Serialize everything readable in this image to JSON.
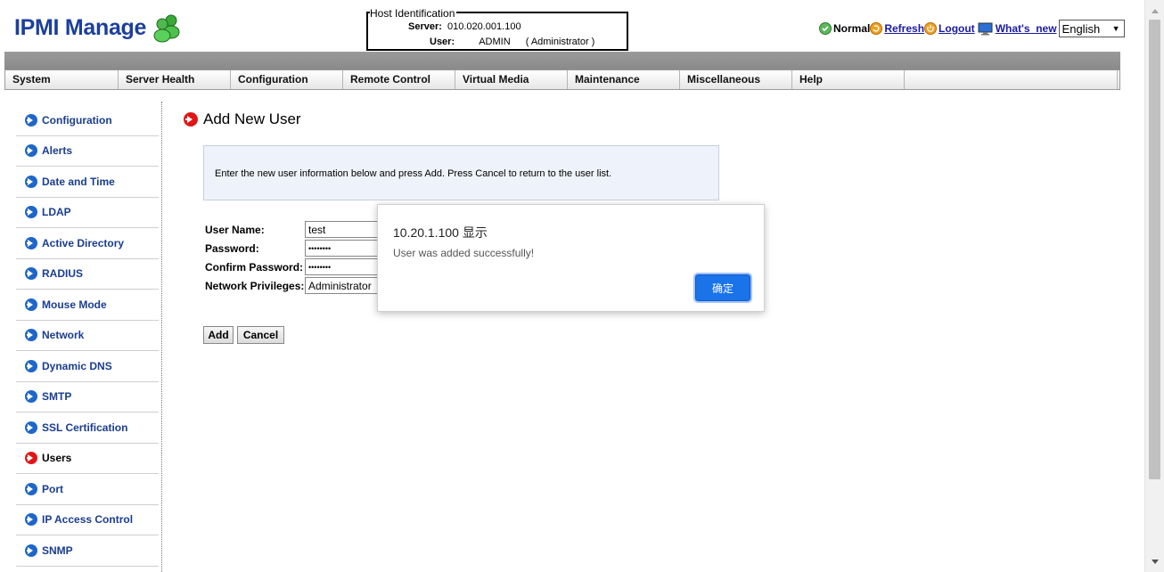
{
  "header": {
    "logo_text": "IPMI Manage",
    "host_identification": {
      "title": "Host Identification",
      "server_label": "Server:",
      "server_value": "010.020.001.100",
      "user_label": "User:",
      "user_value": "ADMIN",
      "user_role": "( Administrator )"
    },
    "status_text": "Normal",
    "refresh_label": "Refresh",
    "logout_label": "Logout",
    "whats_new_label": "What's  new",
    "language": "English"
  },
  "nav": [
    {
      "label": "System",
      "width": 127
    },
    {
      "label": "Server Health",
      "width": 126
    },
    {
      "label": "Configuration",
      "width": 126
    },
    {
      "label": "Remote Control",
      "width": 126
    },
    {
      "label": "Virtual Media",
      "width": 126
    },
    {
      "label": "Maintenance",
      "width": 126
    },
    {
      "label": "Miscellaneous",
      "width": 126
    },
    {
      "label": "Help",
      "width": 126
    },
    {
      "label": "",
      "width": 239
    }
  ],
  "sidebar": {
    "items": [
      {
        "label": "Configuration",
        "active": false
      },
      {
        "label": "Alerts",
        "active": false
      },
      {
        "label": "Date and Time",
        "active": false
      },
      {
        "label": "LDAP",
        "active": false
      },
      {
        "label": "Active Directory",
        "active": false
      },
      {
        "label": "RADIUS",
        "active": false
      },
      {
        "label": "Mouse Mode",
        "active": false
      },
      {
        "label": "Network",
        "active": false
      },
      {
        "label": "Dynamic DNS",
        "active": false
      },
      {
        "label": "SMTP",
        "active": false
      },
      {
        "label": "SSL Certification",
        "active": false
      },
      {
        "label": "Users",
        "active": true
      },
      {
        "label": "Port",
        "active": false
      },
      {
        "label": "IP Access Control",
        "active": false
      },
      {
        "label": "SNMP",
        "active": false
      }
    ]
  },
  "main": {
    "title": "Add New User",
    "info": "Enter the new user information below and press Add. Press Cancel to return to the user list.",
    "form": {
      "username_label": "User Name:",
      "username_value": "test",
      "password_label": "Password:",
      "password_value": "••••••••",
      "confirm_label": "Confirm Password:",
      "confirm_value": "••••••••",
      "privileges_label": "Network Privileges:",
      "privileges_value": "Administrator"
    },
    "add_label": "Add",
    "cancel_label": "Cancel"
  },
  "dialog": {
    "title": "10.20.1.100 显示",
    "message": "User was added successfully!",
    "ok_label": "确定"
  }
}
